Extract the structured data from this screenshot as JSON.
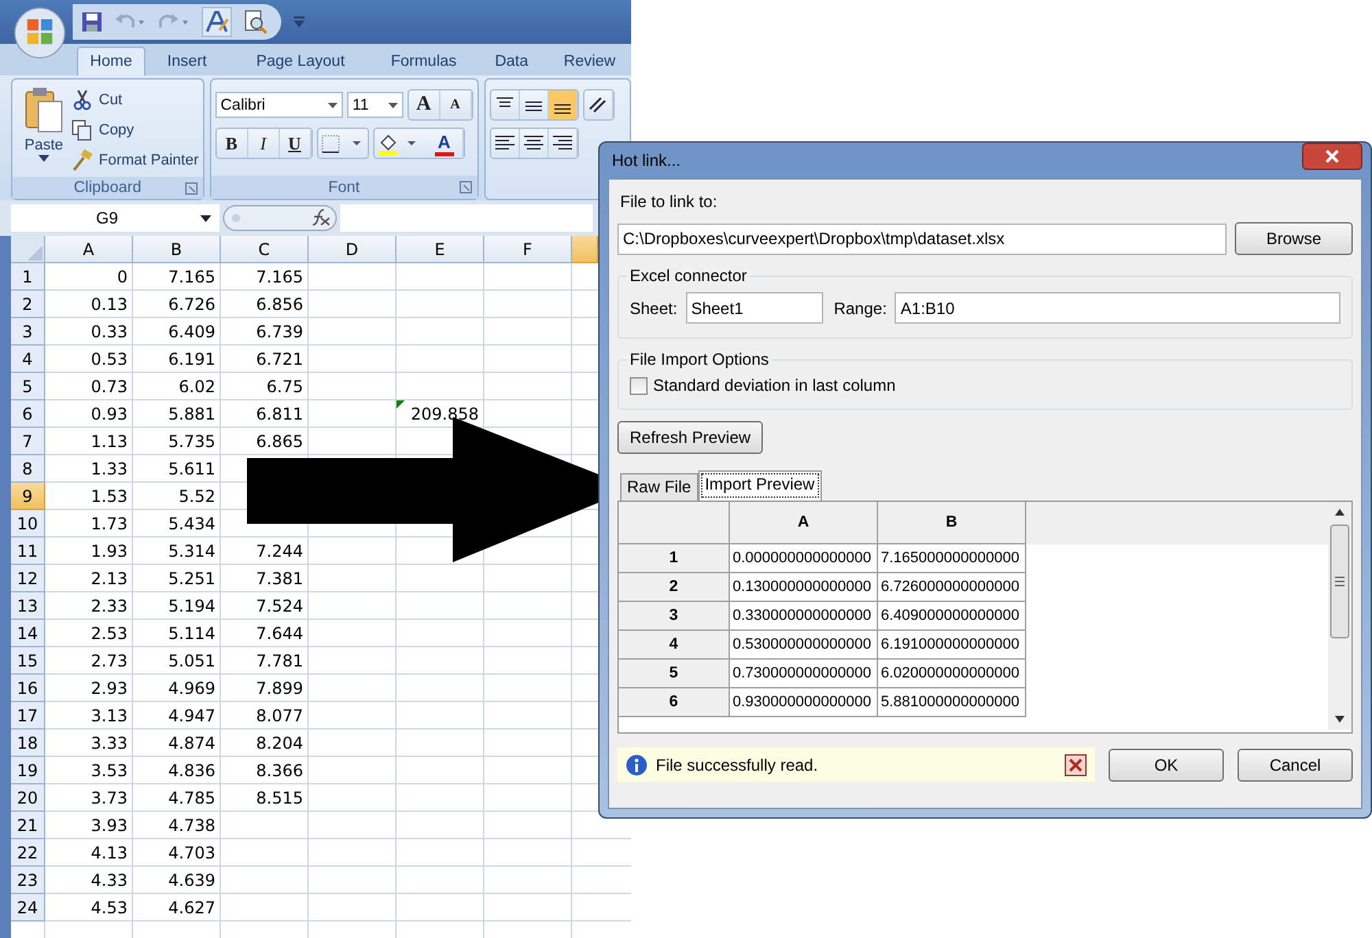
{
  "excel": {
    "ribbon_tabs": [
      {
        "label": "Home",
        "selected": true
      },
      {
        "label": "Insert",
        "selected": false
      },
      {
        "label": "Page Layout",
        "selected": false
      },
      {
        "label": "Formulas",
        "selected": false
      },
      {
        "label": "Data",
        "selected": false
      },
      {
        "label": "Review",
        "selected": false
      }
    ],
    "clipboard": {
      "paste": "Paste",
      "cut": "Cut",
      "copy": "Copy",
      "format_painter": "Format Painter",
      "group_label": "Clipboard"
    },
    "font": {
      "font_name": "Calibri",
      "font_size": "11",
      "grow": "A",
      "shrink": "A",
      "bold": "B",
      "italic": "I",
      "underline": "U",
      "font_color": "A",
      "group_label": "Font"
    },
    "name_box": "G9",
    "columns": [
      {
        "label": "A",
        "selected": false
      },
      {
        "label": "B",
        "selected": false
      },
      {
        "label": "C",
        "selected": false
      },
      {
        "label": "D",
        "selected": false
      },
      {
        "label": "E",
        "selected": false
      },
      {
        "label": "F",
        "selected": false
      },
      {
        "selected": true
      }
    ],
    "rows": [
      {
        "label": "1",
        "selected": false,
        "cells": [
          "0",
          "7.165",
          "7.165"
        ]
      },
      {
        "label": "2",
        "selected": false,
        "cells": [
          "0.13",
          "6.726",
          "6.856"
        ]
      },
      {
        "label": "3",
        "selected": false,
        "cells": [
          "0.33",
          "6.409",
          "6.739"
        ]
      },
      {
        "label": "4",
        "selected": false,
        "cells": [
          "0.53",
          "6.191",
          "6.721"
        ]
      },
      {
        "label": "5",
        "selected": false,
        "cells": [
          "0.73",
          "6.02",
          "6.75"
        ]
      },
      {
        "label": "6",
        "selected": false,
        "cells": [
          "0.93",
          "5.881",
          "6.811",
          null,
          {
            "text": "209.858",
            "error_mark": true
          }
        ]
      },
      {
        "label": "7",
        "selected": false,
        "cells": [
          "1.13",
          "5.735",
          "6.865"
        ]
      },
      {
        "label": "8",
        "selected": false,
        "cells": [
          "1.33",
          "5.611"
        ]
      },
      {
        "label": "9",
        "selected": true,
        "cells": [
          "1.53",
          "5.52"
        ]
      },
      {
        "label": "10",
        "selected": false,
        "cells": [
          "1.73",
          "5.434"
        ]
      },
      {
        "label": "11",
        "selected": false,
        "cells": [
          "1.93",
          "5.314",
          "7.244"
        ]
      },
      {
        "label": "12",
        "selected": false,
        "cells": [
          "2.13",
          "5.251",
          "7.381"
        ]
      },
      {
        "label": "13",
        "selected": false,
        "cells": [
          "2.33",
          "5.194",
          "7.524"
        ]
      },
      {
        "label": "14",
        "selected": false,
        "cells": [
          "2.53",
          "5.114",
          "7.644"
        ]
      },
      {
        "label": "15",
        "selected": false,
        "cells": [
          "2.73",
          "5.051",
          "7.781"
        ]
      },
      {
        "label": "16",
        "selected": false,
        "cells": [
          "2.93",
          "4.969",
          "7.899"
        ]
      },
      {
        "label": "17",
        "selected": false,
        "cells": [
          "3.13",
          "4.947",
          "8.077"
        ]
      },
      {
        "label": "18",
        "selected": false,
        "cells": [
          "3.33",
          "4.874",
          "8.204"
        ]
      },
      {
        "label": "19",
        "selected": false,
        "cells": [
          "3.53",
          "4.836",
          "8.366"
        ]
      },
      {
        "label": "20",
        "selected": false,
        "cells": [
          "3.73",
          "4.785",
          "8.515"
        ]
      },
      {
        "label": "21",
        "selected": false,
        "cells": [
          "3.93",
          "4.738"
        ]
      },
      {
        "label": "22",
        "selected": false,
        "cells": [
          "4.13",
          "4.703"
        ]
      },
      {
        "label": "23",
        "selected": false,
        "cells": [
          "4.33",
          "4.639"
        ]
      },
      {
        "label": "24",
        "selected": false,
        "cells": [
          "4.53",
          "4.627"
        ]
      }
    ]
  },
  "dialog": {
    "title": "Hot link...",
    "file_label": "File to link to:",
    "file_path": "C:\\Dropboxes\\curveexpert\\Dropbox\\tmp\\dataset.xlsx",
    "browse": "Browse",
    "connector": {
      "title": "Excel connector",
      "sheet_label": "Sheet:",
      "sheet": "Sheet1",
      "range_label": "Range:",
      "range": "A1:B10"
    },
    "import_options": {
      "title": "File Import Options",
      "checkbox": {
        "label": "Standard deviation in last column",
        "checked": false
      }
    },
    "refresh": "Refresh Preview",
    "tabs": [
      {
        "label": "Raw File",
        "selected": false
      },
      {
        "label": "Import Preview",
        "selected": true
      }
    ],
    "preview": {
      "columns": [
        "A",
        "B"
      ],
      "rows": [
        {
          "label": "1",
          "cells": [
            "0.000000000000000",
            "7.165000000000000"
          ]
        },
        {
          "label": "2",
          "cells": [
            "0.130000000000000",
            "6.726000000000000"
          ]
        },
        {
          "label": "3",
          "cells": [
            "0.330000000000000",
            "6.409000000000000"
          ]
        },
        {
          "label": "4",
          "cells": [
            "0.530000000000000",
            "6.191000000000000"
          ]
        },
        {
          "label": "5",
          "cells": [
            "0.730000000000000",
            "6.020000000000000"
          ]
        },
        {
          "label": "6",
          "cells": [
            "0.930000000000000",
            "5.881000000000000"
          ]
        }
      ]
    },
    "status": "File successfully read.",
    "ok": "OK",
    "cancel": "Cancel"
  }
}
